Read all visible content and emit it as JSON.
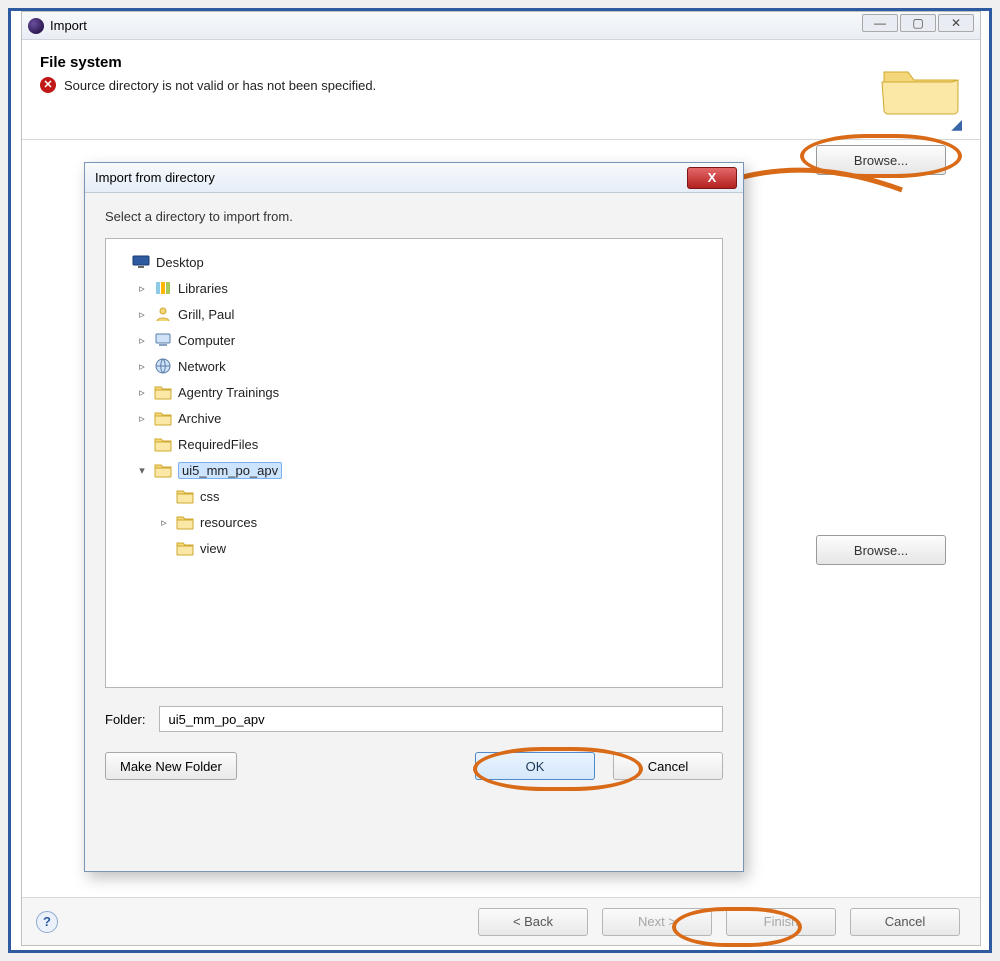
{
  "import_window": {
    "title": "Import",
    "banner_title": "File system",
    "error_text": "Source directory is not valid or has not been specified.",
    "browse1_label": "Browse...",
    "browse2_label": "Browse...",
    "back_label": "< Back",
    "next_label": "Next >",
    "finish_label": "Finish",
    "cancel_label": "Cancel",
    "help_label": "?"
  },
  "dir_dialog": {
    "title": "Import from directory",
    "close_label": "X",
    "instruction": "Select a directory to import from.",
    "folder_label": "Folder:",
    "folder_value": "ui5_mm_po_apv",
    "make_folder_label": "Make New Folder",
    "ok_label": "OK",
    "cancel_label": "Cancel",
    "tree": {
      "root": "Desktop",
      "items": [
        {
          "exp": "▹",
          "icon": "libraries",
          "label": "Libraries"
        },
        {
          "exp": "▹",
          "icon": "user",
          "label": "Grill, Paul"
        },
        {
          "exp": "▹",
          "icon": "computer",
          "label": "Computer"
        },
        {
          "exp": "▹",
          "icon": "network",
          "label": "Network"
        },
        {
          "exp": "▹",
          "icon": "folder",
          "label": "Agentry Trainings"
        },
        {
          "exp": "▹",
          "icon": "folder",
          "label": "Archive"
        },
        {
          "exp": "",
          "icon": "folder",
          "label": "RequiredFiles"
        },
        {
          "exp": "▾",
          "icon": "folder",
          "label": "ui5_mm_po_apv",
          "selected": true,
          "children": [
            {
              "exp": "",
              "icon": "folder",
              "label": "css"
            },
            {
              "exp": "▹",
              "icon": "folder",
              "label": "resources"
            },
            {
              "exp": "",
              "icon": "folder",
              "label": "view"
            }
          ]
        }
      ]
    }
  }
}
